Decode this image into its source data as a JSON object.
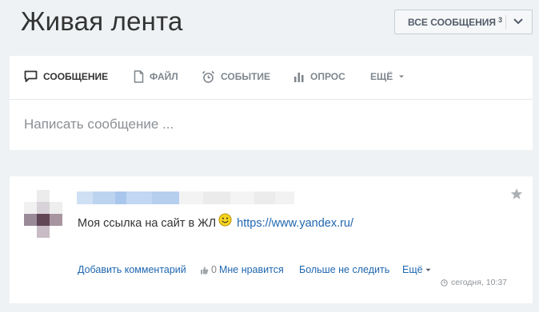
{
  "page": {
    "title": "Живая лента",
    "filter_label": "ВСЕ СООБЩЕНИЯ",
    "filter_count": "3"
  },
  "composer": {
    "tabs": [
      {
        "label": "СООБЩЕНИЕ",
        "icon": "message-icon",
        "active": true
      },
      {
        "label": "ФАЙЛ",
        "icon": "file-icon",
        "active": false
      },
      {
        "label": "СОБЫТИЕ",
        "icon": "alarm-clock-icon",
        "active": false
      },
      {
        "label": "ОПРОС",
        "icon": "poll-icon",
        "active": false
      },
      {
        "label": "ЕЩЁ",
        "icon": "caret-down-icon",
        "active": false
      }
    ],
    "placeholder": "Написать сообщение ..."
  },
  "post": {
    "text": "Моя ссылка на сайт в ЖЛ",
    "link": "https://www.yandex.ru/",
    "actions": {
      "comment": "Добавить комментарий",
      "like_count": "0",
      "like": "Мне нравится",
      "unfollow": "Больше не следить",
      "more": "Ещё"
    },
    "timestamp": "сегодня, 10:37"
  },
  "colors": {
    "background": "#eef2f4",
    "card": "#ffffff",
    "link": "#2067b0",
    "muted": "#7f868d"
  }
}
